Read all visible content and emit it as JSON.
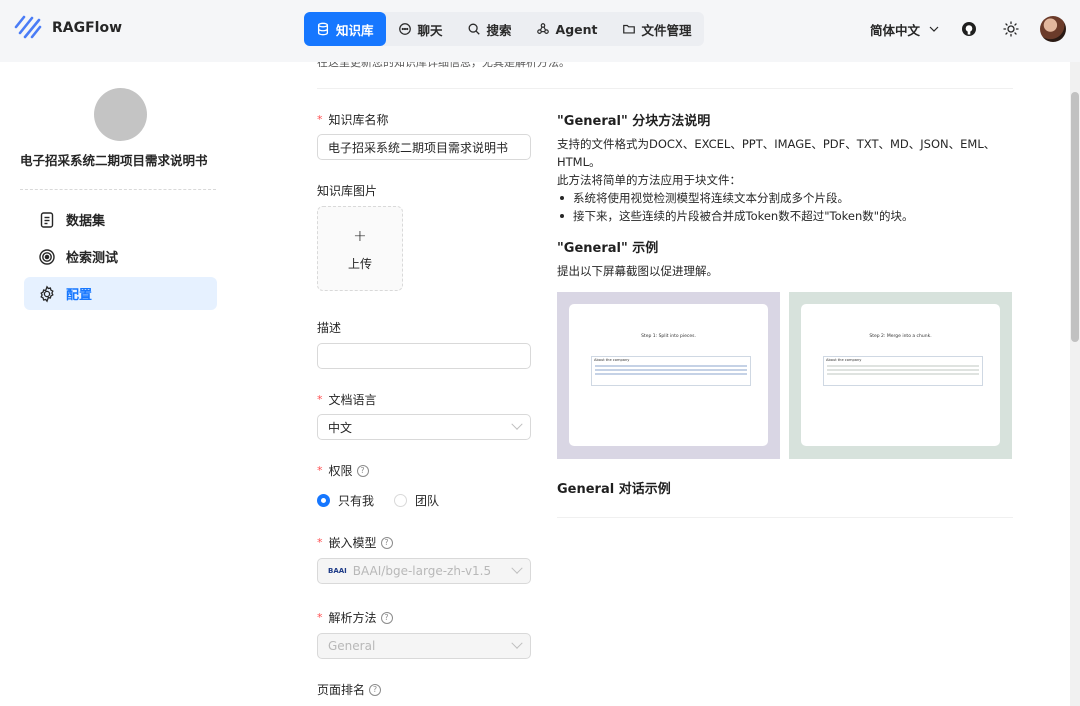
{
  "app": {
    "name": "RAGFlow"
  },
  "nav": {
    "items": [
      {
        "label": "知识库",
        "icon": "database-icon",
        "active": true
      },
      {
        "label": "聊天",
        "icon": "chat-icon"
      },
      {
        "label": "搜索",
        "icon": "search-icon"
      },
      {
        "label": "Agent",
        "icon": "agent-icon"
      },
      {
        "label": "文件管理",
        "icon": "folder-icon"
      }
    ]
  },
  "header": {
    "language": "简体中文"
  },
  "sidebar": {
    "kb_name": "电子招采系统二期项目需求说明书",
    "items": [
      {
        "label": "数据集",
        "icon": "document-icon"
      },
      {
        "label": "检索测试",
        "icon": "target-icon"
      },
      {
        "label": "配置",
        "icon": "gear-icon",
        "active": true
      }
    ]
  },
  "form": {
    "intro": "在这里更新您的知识库详细信息，尤其是解析方法。",
    "name_label": "知识库名称",
    "name_value": "电子招采系统二期项目需求说明书",
    "image_label": "知识库图片",
    "upload_plus": "+",
    "upload_label": "上传",
    "desc_label": "描述",
    "desc_value": "",
    "language_label": "文档语言",
    "language_value": "中文",
    "permission_label": "权限",
    "permission_options": [
      "只有我",
      "团队"
    ],
    "embedding_label": "嵌入模型",
    "embedding_value": "BAAI/bge-large-zh-v1.5",
    "embedding_logo": "BAAI",
    "parse_label": "解析方法",
    "parse_value": "General",
    "page_rank_label": "页面排名"
  },
  "description": {
    "title": "\"General\" 分块方法说明",
    "formats": "支持的文件格式为DOCX、EXCEL、PPT、IMAGE、PDF、TXT、MD、JSON、EML、HTML。",
    "method": "此方法将简单的方法应用于块文件：",
    "bullets": [
      "系统将使用视觉检测模型将连续文本分割成多个片段。",
      "接下来，这些连续的片段被合并成Token数不超过\"Token数\"的块。"
    ],
    "example_title": "\"General\" 示例",
    "example_text": "提出以下屏幕截图以促进理解。",
    "shot1_title": "Step 1: Split into pieces.",
    "shot2_title": "Step 2: Merge into a chunk.",
    "shot_section": "About the company",
    "shot1_bg": "#d9d6e4",
    "shot2_bg": "#d7e2dc",
    "dialog_title": "General 对话示例"
  }
}
